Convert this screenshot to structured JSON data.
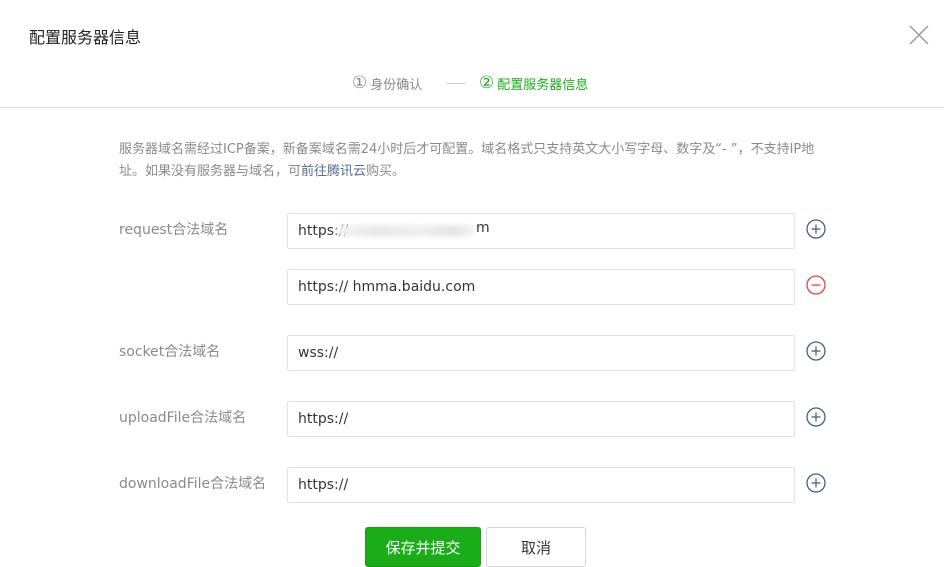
{
  "dialog": {
    "title": "配置服务器信息",
    "close_icon": "close-icon"
  },
  "steps": [
    {
      "number": "①",
      "label": "身份确认"
    },
    {
      "number": "②",
      "label": "配置服务器信息"
    }
  ],
  "description": {
    "text_before_link": "服务器域名需经过ICP备案，新备案域名需24小时后才可配置。域名格式只支持英文大小写字母、数字及“- ”，不支持IP地址。如果没有服务器与域名，可",
    "link_text": "前往腾讯云",
    "text_after_link": "购买。"
  },
  "form": {
    "request": {
      "label": "request合法域名",
      "fields": [
        {
          "value": "https://",
          "masked_tail": "m",
          "action_icon": "add-circle-icon"
        },
        {
          "value": "https:// hmma.baidu.com",
          "action_icon": "remove-circle-icon"
        }
      ]
    },
    "socket": {
      "label": "socket合法域名",
      "value": "wss://",
      "action_icon": "add-circle-icon"
    },
    "uploadFile": {
      "label": "uploadFile合法域名",
      "value": "https://",
      "action_icon": "add-circle-icon"
    },
    "downloadFile": {
      "label": "downloadFile合法域名",
      "value": "https://",
      "action_icon": "add-circle-icon"
    }
  },
  "buttons": {
    "save_label": "保存并提交",
    "cancel_label": "取消"
  },
  "colors": {
    "brand_green": "#1aad19",
    "link_blue": "#576b95",
    "remove_red": "#e64340",
    "icon_blue": "#4b5d7b",
    "muted_text": "#8a8a8a"
  }
}
